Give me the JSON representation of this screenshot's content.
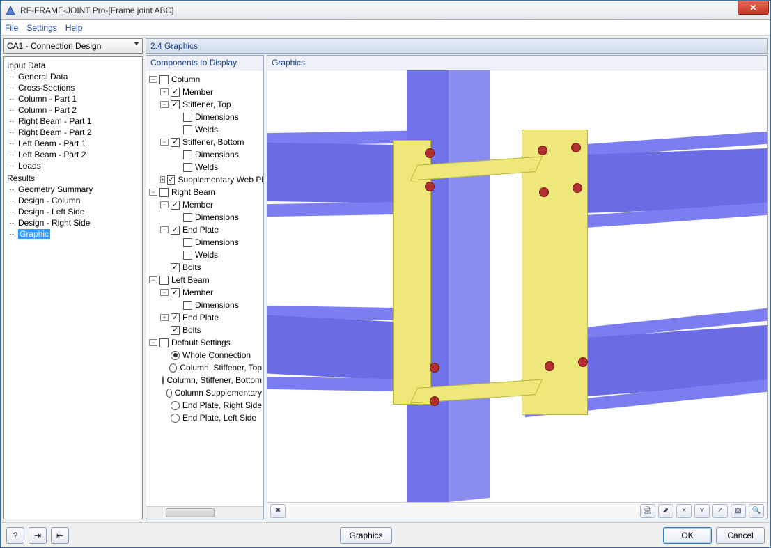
{
  "window": {
    "app_name": "RF-FRAME-JOINT Pro",
    "doc_name": "[Frame joint ABC]",
    "title_sep": " - "
  },
  "menu": {
    "file": "File",
    "settings": "Settings",
    "help": "Help"
  },
  "left": {
    "combo": "CA1 - Connection Design",
    "input_data_header": "Input Data",
    "input_data_items": [
      "General Data",
      "Cross-Sections",
      "Column - Part 1",
      "Column - Part 2",
      "Right Beam - Part 1",
      "Right Beam - Part 2",
      "Left Beam - Part 1",
      "Left Beam - Part 2",
      "Loads"
    ],
    "results_header": "Results",
    "results_items": [
      "Geometry Summary",
      "Design - Column",
      "Design - Left Side",
      "Design - Right Side",
      "Graphic"
    ],
    "selected": "Graphic"
  },
  "main": {
    "section_title": "2.4 Graphics",
    "components_header": "Components to Display",
    "graphics_header": "Graphics"
  },
  "tree": {
    "column": "Column",
    "member": "Member",
    "stiff_top": "Stiffener, Top",
    "dimensions": "Dimensions",
    "welds": "Welds",
    "stiff_bot": "Stiffener, Bottom",
    "supp_web": "Supplementary Web Plate",
    "right_beam": "Right Beam",
    "end_plate": "End Plate",
    "bolts": "Bolts",
    "left_beam": "Left Beam",
    "default_settings": "Default Settings",
    "ds_whole": "Whole Connection",
    "ds_col_top": "Column, Stiffener, Top",
    "ds_col_bot": "Column, Stiffener, Bottom",
    "ds_col_supp": "Column Supplementary",
    "ds_ep_right": "End Plate, Right Side",
    "ds_ep_left": "End Plate, Left Side"
  },
  "buttons": {
    "graphics": "Graphics",
    "ok": "OK",
    "cancel": "Cancel"
  },
  "toolbar_icons": [
    "print-icon",
    "axes-icon",
    "view-x-icon",
    "view-y-icon",
    "view-z-icon",
    "iso-icon",
    "zoom-icon"
  ],
  "toolbar_labels": [
    "🖨",
    "⬈",
    "X",
    "Y",
    "Z",
    "▧",
    "🔍"
  ],
  "bottom_icons": [
    "help-icon",
    "import-icon",
    "export-icon"
  ],
  "bottom_labels": [
    "?",
    "⇥",
    "⇤"
  ]
}
